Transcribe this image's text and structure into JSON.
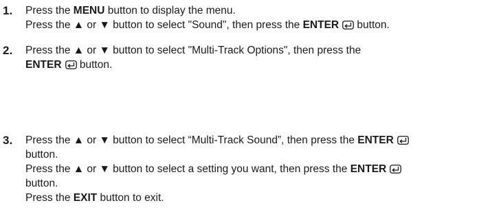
{
  "steps": [
    {
      "number": "1.",
      "lines": [
        {
          "pre": "Press the ",
          "bold": "MENU",
          "post": " button to display the menu."
        },
        {
          "pre": "Press the ▲ or ▼ button to select \"Sound\", then press the ",
          "bold": "ENTER",
          "post": " button."
        }
      ]
    },
    {
      "number": "2.",
      "lines": [
        {
          "pre": "Press the ▲ or ▼ button to select \"Multi-Track Options\", then press the"
        },
        {
          "pre": "",
          "bold": "ENTER",
          "post": " button."
        }
      ]
    },
    {
      "number": "3.",
      "lines": [
        {
          "pre": "Press the ▲ or ▼ button to select “Multi-Track Sound”, then press the ",
          "bold": "ENTER"
        },
        {
          "pre": "button."
        },
        {
          "pre": "Press the ▲ or ▼ button to select a setting you want, then press the ",
          "bold": "ENTER"
        },
        {
          "pre": "button."
        },
        {
          "pre": "Press the ",
          "bold": "EXIT",
          "post": " button to exit."
        }
      ]
    }
  ]
}
